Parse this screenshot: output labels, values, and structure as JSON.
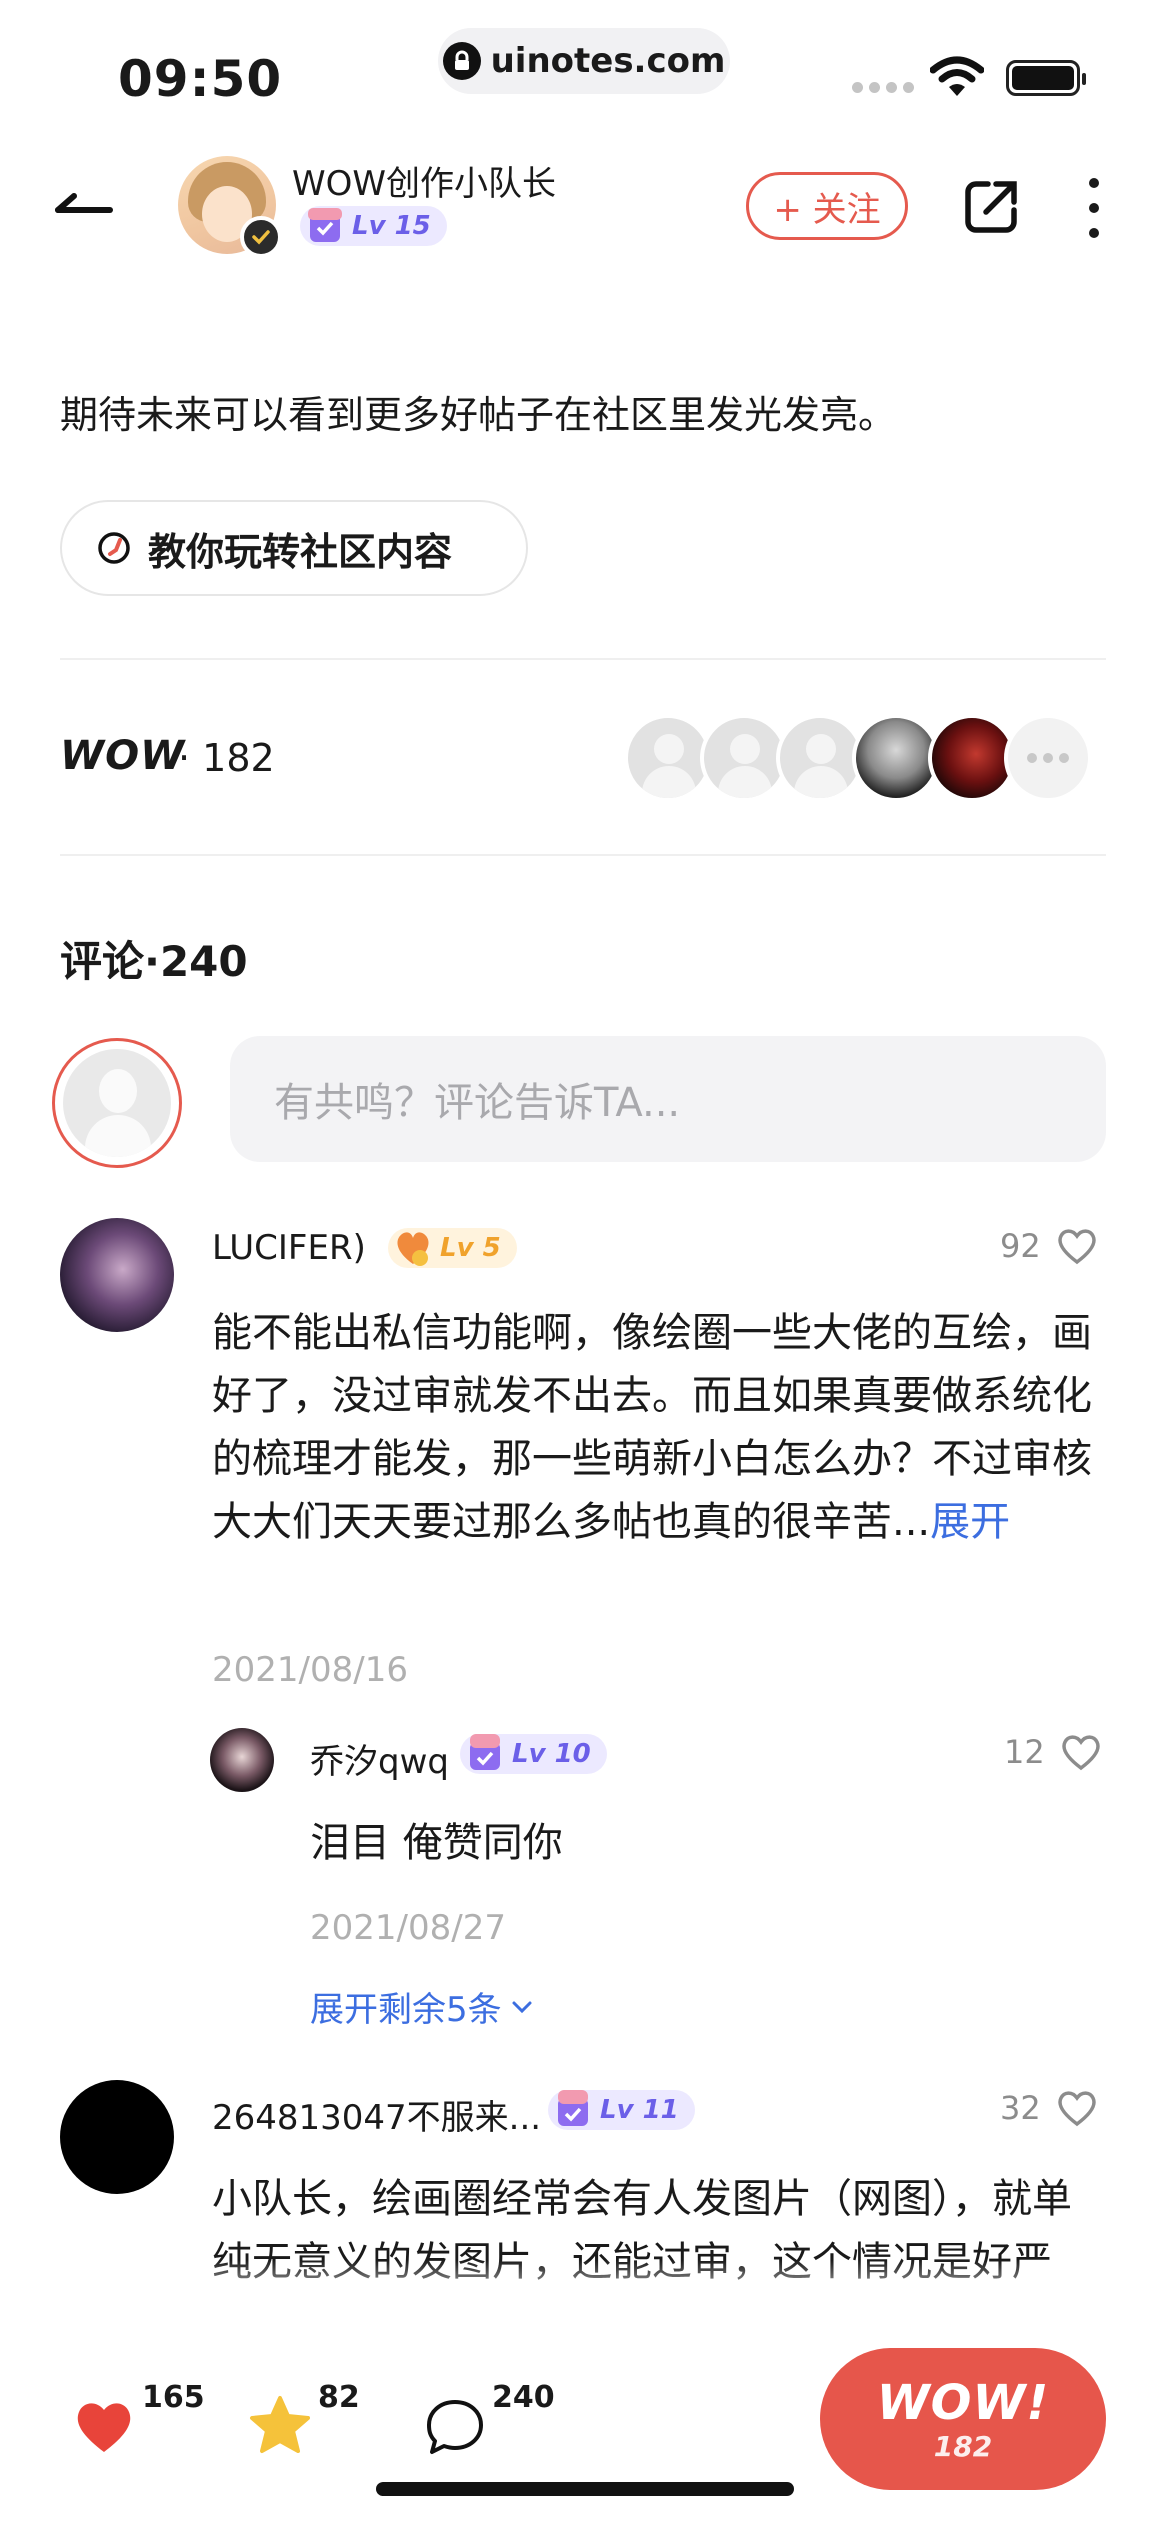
{
  "status_bar": {
    "time": "09:50",
    "url": "uinotes.com"
  },
  "header": {
    "author_name": "WOW创作小队长",
    "author_level": "Lv 15",
    "follow_label": "+ 关注"
  },
  "post": {
    "text": "期待未来可以看到更多好帖子在社区里发光发亮。",
    "guide_label": "教你玩转社区内容"
  },
  "wow": {
    "label": "WOW",
    "count": "· 182"
  },
  "comments": {
    "title": "评论·240",
    "input_placeholder": "有共鸣？评论告诉TA...",
    "items": [
      {
        "name": "LUCIFER)",
        "level": "Lv 5",
        "likes": "92",
        "text": "能不能出私信功能啊，像绘圈一些大佬的互绘，画好了，没过审就发不出去。而且如果真要做系统化的梳理才能发，那一些萌新小白怎么办？不过审核大大们天天要过那么多帖也真的很辛苦...",
        "expand": "展开",
        "date": "2021/08/16",
        "reply": {
          "name": "乔汐qwq",
          "level": "Lv 10",
          "likes": "12",
          "text": "泪目 俺赞同你",
          "date": "2021/08/27"
        },
        "more_replies": "展开剩余5条"
      },
      {
        "name": "264813047不服来...",
        "level": "Lv 11",
        "likes": "32",
        "text": "小队长，绘画圈经常会有人发图片（网图），就单纯无意义的发图片，还能过审，这个情况是好严格管理一下下"
      }
    ]
  },
  "bottom_bar": {
    "likes": "165",
    "favorites": "82",
    "comments": "240",
    "wow_button": "WOW!",
    "wow_count": "182"
  },
  "colors": {
    "accent": "#e6564b",
    "link": "#3c6ee0",
    "level_purple": "#6b5fe8",
    "level_gold": "#f0a22c"
  }
}
